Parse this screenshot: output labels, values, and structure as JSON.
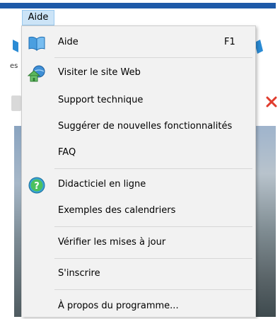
{
  "menubar": {
    "aide_label": "Aide"
  },
  "background": {
    "partial_label": "es"
  },
  "menu": {
    "aide": {
      "label": "Aide",
      "shortcut": "F1"
    },
    "website": {
      "label": "Visiter le site Web"
    },
    "support": {
      "label": "Support technique"
    },
    "suggest": {
      "label": "Suggérer de nouvelles fonctionnalités"
    },
    "faq": {
      "label": "FAQ"
    },
    "tutorial": {
      "label": "Didacticiel en ligne"
    },
    "examples": {
      "label": "Exemples des calendriers"
    },
    "updates": {
      "label": "Vérifier les mises à jour"
    },
    "register": {
      "label": "S'inscrire"
    },
    "about": {
      "label": "À propos du programme..."
    }
  },
  "icons": {
    "aide": "book-icon",
    "website": "globe-home-icon",
    "tutorial": "help-circle-icon"
  },
  "colors": {
    "menubar_accent": "#1e5aa8",
    "menu_highlight": "#cce4f7",
    "menu_background": "#f2f2f2"
  }
}
